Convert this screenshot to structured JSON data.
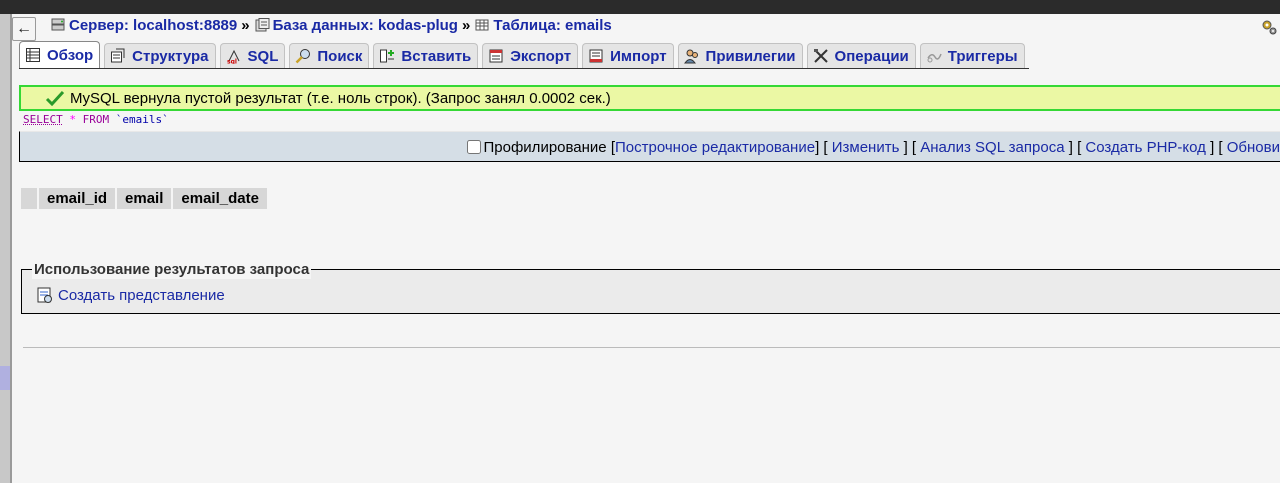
{
  "breadcrumb": {
    "server_label": "Сервер: localhost:8889",
    "database_label": "База данных: kodas-plug",
    "table_label": "Таблица: emails",
    "separator": "»"
  },
  "back_button": "←",
  "tabs": [
    {
      "label": "Обзор",
      "icon": "browse-icon",
      "active": true
    },
    {
      "label": "Структура",
      "icon": "structure-icon"
    },
    {
      "label": "SQL",
      "icon": "sql-icon"
    },
    {
      "label": "Поиск",
      "icon": "search-icon"
    },
    {
      "label": "Вставить",
      "icon": "insert-icon"
    },
    {
      "label": "Экспорт",
      "icon": "export-icon"
    },
    {
      "label": "Импорт",
      "icon": "import-icon"
    },
    {
      "label": "Привилегии",
      "icon": "privileges-icon"
    },
    {
      "label": "Операции",
      "icon": "operations-icon"
    },
    {
      "label": "Триггеры",
      "icon": "triggers-icon"
    }
  ],
  "notice": {
    "text": "MySQL вернула пустой результат (т.е. ноль строк). (Запрос занял 0.0002 сек.)"
  },
  "sql": {
    "select": "SELECT",
    "star": "*",
    "from": "FROM",
    "table": "`emails`"
  },
  "sql_links": {
    "profiling": "Профилирование",
    "inline_edit": "Построчное редактирование",
    "edit": "Изменить",
    "explain": "Анализ SQL запроса",
    "create_php": "Создать PHP-код",
    "refresh": "Обнови"
  },
  "columns": [
    "email_id",
    "email",
    "email_date"
  ],
  "query_results": {
    "legend": "Использование результатов запроса",
    "create_view": "Создать представление"
  },
  "colors": {
    "link": "#1a2aa5",
    "notice_bg": "#ebf8a4",
    "notice_border": "#35d835",
    "sql_box_bg": "#d5dee6"
  }
}
